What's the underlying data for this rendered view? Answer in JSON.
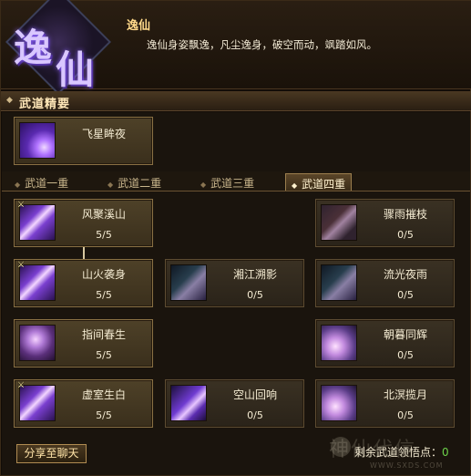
{
  "header": {
    "emblem_chars": [
      "逸",
      "仙"
    ],
    "class_name": "逸仙",
    "description": "逸仙身姿飘逸，凡尘逸身，破空而动，飒踏如风。"
  },
  "section": {
    "title": "武道精要"
  },
  "featured_skill": {
    "name": "飞星眸夜"
  },
  "tabs": [
    {
      "label": "武道一重",
      "active": false
    },
    {
      "label": "武道二重",
      "active": false
    },
    {
      "label": "武道三重",
      "active": false
    },
    {
      "label": "武道四重",
      "active": true
    }
  ],
  "skills": {
    "r1c1": {
      "name": "风聚溪山",
      "level": "5/5",
      "icon": "sword-wave-icon"
    },
    "r1c3": {
      "name": "骤雨摧枝",
      "level": "0/5",
      "icon": "rain-strike-icon"
    },
    "r2c1": {
      "name": "山火袭身",
      "level": "5/5",
      "icon": "sword-wave-icon"
    },
    "r2c2": {
      "name": "湘江溯影",
      "level": "0/5",
      "icon": "river-shadow-icon"
    },
    "r2c3": {
      "name": "流光夜雨",
      "level": "0/5",
      "icon": "night-rain-icon"
    },
    "r3c1": {
      "name": "指间春生",
      "level": "5/5",
      "icon": "spring-orb-icon"
    },
    "r3c3": {
      "name": "朝暮同辉",
      "level": "0/5",
      "icon": "dusk-dawn-icon"
    },
    "r4c1": {
      "name": "虚室生白",
      "level": "5/5",
      "icon": "sword-wave-icon"
    },
    "r4c2": {
      "name": "空山回响",
      "level": "0/5",
      "icon": "echo-icon"
    },
    "r4c3": {
      "name": "北溟揽月",
      "level": "0/5",
      "icon": "moon-embrace-icon"
    }
  },
  "footer": {
    "share_label": "分享至聊天",
    "points_label": "剩余武道领悟点：",
    "points_value": "0",
    "watermark": "神仙代信",
    "watermark_url": "WWW.SXDS.COM"
  },
  "colors": {
    "accent": "#ffd98a",
    "points_green": "#6dd24a",
    "card_border": "#8a7144"
  }
}
